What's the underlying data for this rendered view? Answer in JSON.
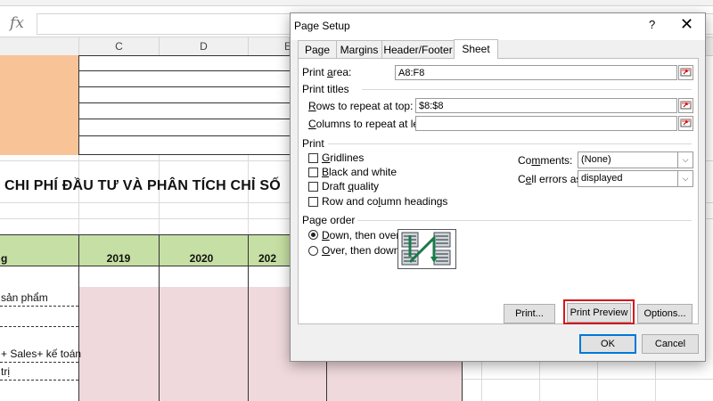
{
  "formula_bar": {
    "fx_label": "fx",
    "value": ""
  },
  "columns": [
    "C",
    "D",
    "E"
  ],
  "sheet": {
    "title": "CHI PHÍ ĐẦU TƯ VÀ PHÂN TÍCH CHỈ SỐ",
    "years": [
      "2019",
      "2020",
      "202"
    ],
    "header_partial": "g",
    "rows": [
      "sản phẩm",
      "+ Sales+ kế toán",
      "trị"
    ],
    "colors": {
      "orange": "#f8c396",
      "green": "#c6dfa4",
      "pink": "#f0d9dc"
    }
  },
  "dialog": {
    "title": "Page Setup",
    "help": "?",
    "close": "✕",
    "tabs": [
      "Page",
      "Margins",
      "Header/Footer",
      "Sheet"
    ],
    "active_tab": "Sheet",
    "print_area": {
      "label": "Print area:",
      "value": "A8:F8"
    },
    "print_titles": {
      "label": "Print titles",
      "rows_label": "Rows to repeat at top:",
      "rows_value": "$8:$8",
      "cols_label": "Columns to repeat at left:",
      "cols_value": ""
    },
    "print": {
      "label": "Print",
      "gridlines": "Gridlines",
      "black_white": "Black and white",
      "draft": "Draft quality",
      "headings": "Row and column headings",
      "comments_label": "Comments:",
      "comments_value": "(None)",
      "errors_label": "Cell errors as:",
      "errors_value": "displayed"
    },
    "page_order": {
      "label": "Page order",
      "down_over": "Down, then over",
      "over_down": "Over, then down",
      "selected": "Down, then over"
    },
    "buttons": {
      "print": "Print...",
      "preview": "Print Preview",
      "options": "Options...",
      "ok": "OK",
      "cancel": "Cancel"
    },
    "highlight_color": "#d4161c"
  }
}
